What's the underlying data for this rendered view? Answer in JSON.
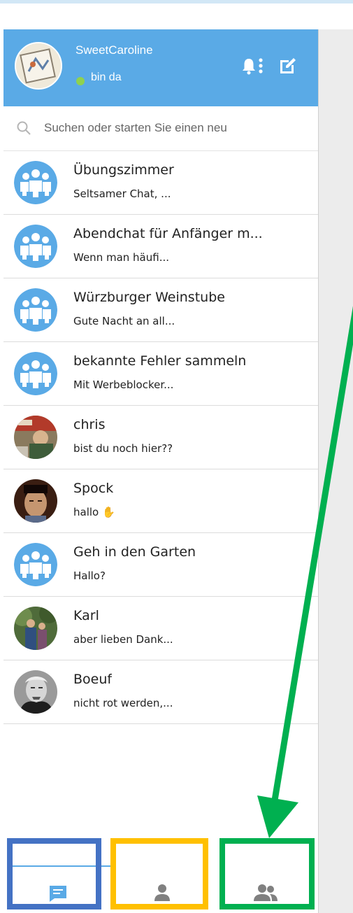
{
  "header": {
    "username": "SweetCaroline",
    "status": "bin da",
    "status_color": "#8fd14f",
    "accent_color": "#5aaae6",
    "icons": [
      "bell-icon",
      "more-vertical-icon",
      "compose-icon"
    ]
  },
  "search": {
    "placeholder": "Suchen oder starten Sie einen neu",
    "value": ""
  },
  "conversations": [
    {
      "name": "Übungszimmer",
      "preview": "Seltsamer Chat, ...",
      "avatar": "group-icon"
    },
    {
      "name": "Abendchat für Anfänger m...",
      "preview": "Wenn man häufi...",
      "avatar": "group-icon"
    },
    {
      "name": "Würzburger Weinstube",
      "preview": "Gute Nacht an all...",
      "avatar": "group-icon"
    },
    {
      "name": "bekannte Fehler sammeln",
      "preview": "Mit Werbeblocker...",
      "avatar": "group-icon"
    },
    {
      "name": "chris",
      "preview": "bist du noch hier??",
      "avatar": "photo"
    },
    {
      "name": "Spock",
      "preview": "hallo ✋",
      "avatar": "photo"
    },
    {
      "name": "Geh in den Garten",
      "preview": "Hallo?",
      "avatar": "group-icon"
    },
    {
      "name": "Karl",
      "preview": "aber lieben Dank...",
      "avatar": "photo"
    },
    {
      "name": "Boeuf",
      "preview": "nicht rot werden,...",
      "avatar": "photo"
    }
  ],
  "bottom_tabs": [
    {
      "icon": "chat-icon",
      "active": true
    },
    {
      "icon": "contact-icon",
      "active": false
    },
    {
      "icon": "groups-icon",
      "active": false
    }
  ],
  "annotations": {
    "highlight_colors": [
      "#4472c4",
      "#ffc000",
      "#00b050"
    ],
    "arrow_color": "#00b050"
  }
}
